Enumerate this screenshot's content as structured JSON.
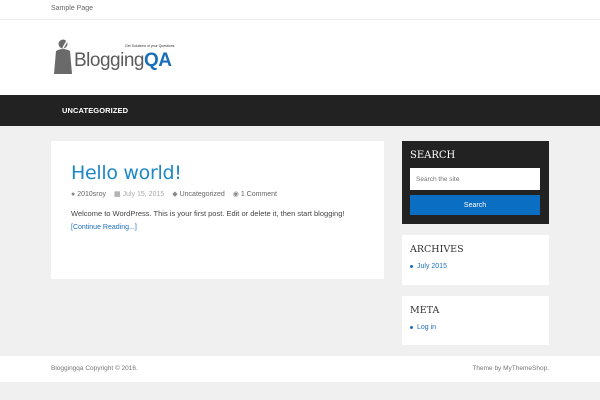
{
  "topbar": {
    "link": "Sample Page"
  },
  "logo": {
    "name_part1": "Blogging",
    "name_part2": "QA",
    "tagline": "Get Solutions of your Questions"
  },
  "nav": {
    "item": "UNCATEGORIZED"
  },
  "post": {
    "title": "Hello world!",
    "author": "2010sroy",
    "date": "July 15, 2015",
    "category": "Uncategorized",
    "comments": "1 Comment",
    "excerpt": "Welcome to WordPress. This is your first post. Edit or delete it, then start blogging!",
    "more": "[Continue Reading...]"
  },
  "search": {
    "title": "SEARCH",
    "placeholder": "Search the site",
    "button": "Search"
  },
  "archives": {
    "title": "ARCHIVES",
    "items": [
      "July 2015"
    ]
  },
  "meta": {
    "title": "META",
    "items": [
      "Log in"
    ]
  },
  "footer": {
    "copyright": "Bloggingqa Copyright © 2016.",
    "theme": "Theme by MyThemeShop."
  },
  "colors": {
    "accent": "#1e88c7",
    "button": "#0a6fc2",
    "nav_bg": "#222222",
    "page_bg": "#f0f0f0"
  },
  "icons": {
    "author": "user-icon",
    "date": "calendar-icon",
    "category": "tag-icon",
    "comments": "comment-icon"
  }
}
